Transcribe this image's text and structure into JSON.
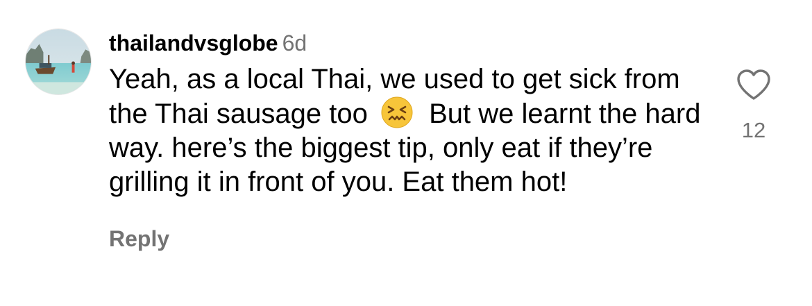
{
  "comment": {
    "username": "thailandvsglobe",
    "time": "6d",
    "text_before_emoji": "Yeah, as a local Thai, we used to get sick from the Thai sausage too",
    "emoji": "confounded-face-emoji",
    "text_after_emoji": "But we learnt the hard way. here’s the biggest tip, only eat if they’re grilling it in front of you. Eat them hot!",
    "reply_label": "Reply",
    "like_count": "12",
    "avatar": "beach-longtail-boat-photo"
  },
  "icons": {
    "like": "heart-outline-icon"
  },
  "colors": {
    "text": "#000000",
    "secondary": "#737373",
    "background": "#ffffff"
  }
}
